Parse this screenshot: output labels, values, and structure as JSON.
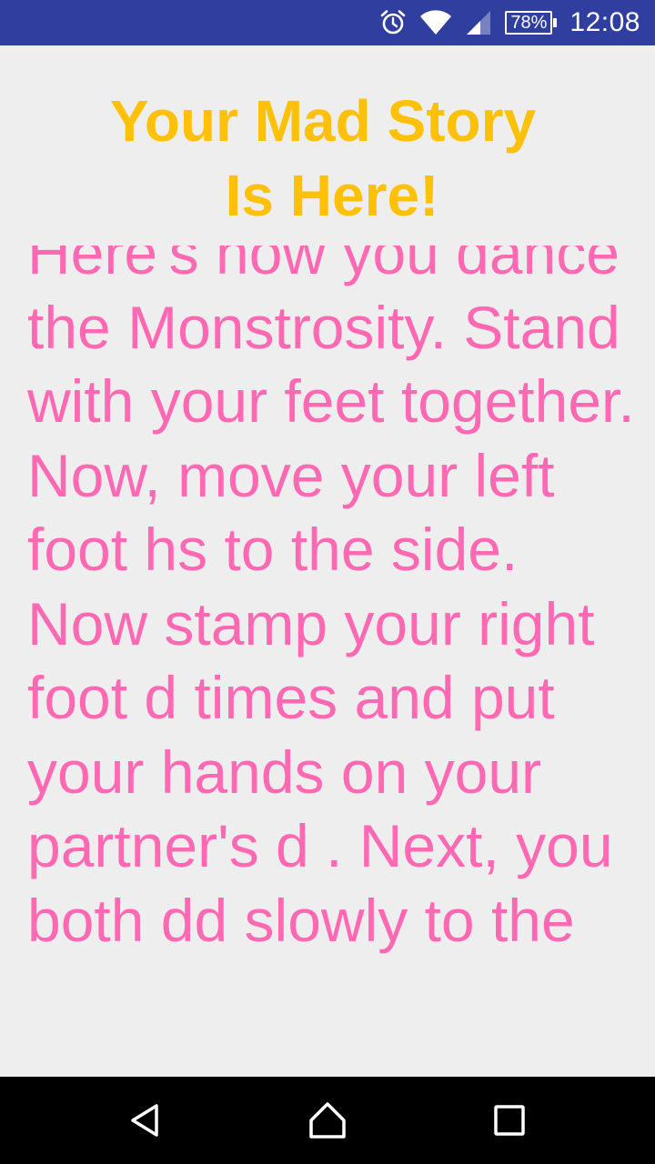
{
  "status_bar": {
    "battery": "78%",
    "time": "12:08",
    "icons": [
      "alarm-icon",
      "wifi-icon",
      "cell-signal-icon",
      "battery-icon"
    ]
  },
  "title": {
    "line1": "Your Mad Story",
    "line2": "Is Here!"
  },
  "story": {
    "text": "Here's how you dance the Monstrosity. Stand with your feet together. Now, move your left foot hs to the side. Now stamp your right foot d times and put your hands on your partner's d . Next, you both dd slowly to the"
  },
  "nav_bar": {
    "icons": [
      "back-icon",
      "home-icon",
      "recents-icon"
    ]
  },
  "colors": {
    "status_bar": "#303f9f",
    "title": "#ffc107",
    "story_text": "#ff69b4",
    "background": "#eeeeee",
    "nav_bar": "#000000"
  }
}
